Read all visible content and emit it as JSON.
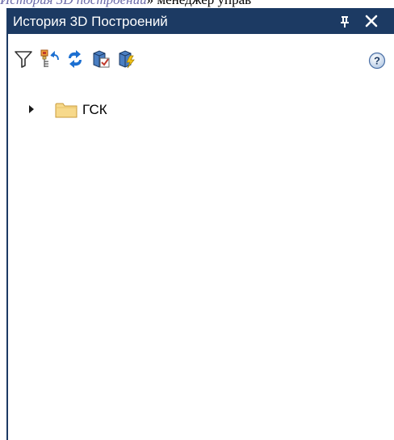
{
  "background_caption": {
    "italic_text": "История 3D построений",
    "rest_text": "» менеджер управ"
  },
  "panel": {
    "title": "История 3D Построений"
  },
  "toolbar": {
    "buttons": [
      {
        "icon": "filter-icon"
      },
      {
        "icon": "collapse-tree-icon"
      },
      {
        "icon": "refresh-icon"
      },
      {
        "icon": "rebuild-check-icon"
      },
      {
        "icon": "rebuild-all-icon"
      }
    ],
    "help_label": "?"
  },
  "tree": {
    "nodes": [
      {
        "label": "ГСК",
        "expanded": false,
        "icon": "folder-icon"
      }
    ]
  },
  "colors": {
    "titlebar": "#1c3a63",
    "folder_fill": "#f7d98b",
    "folder_stroke": "#c89a3a",
    "accent_blue": "#1b6fd1"
  }
}
